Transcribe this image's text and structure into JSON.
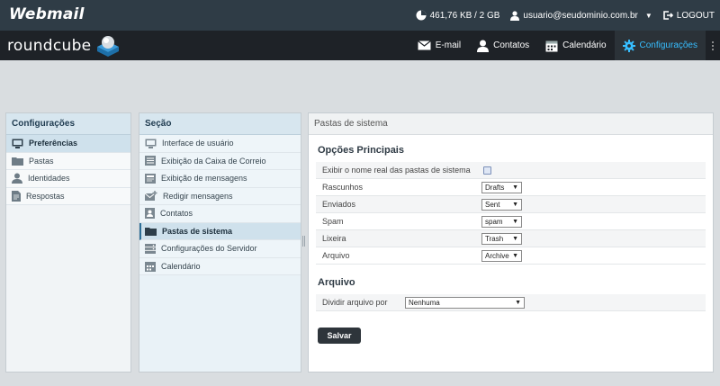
{
  "topbar": {
    "brand": "Webmail",
    "quota": "461,76 KB / 2 GB",
    "user": "usuario@seudominio.com.br",
    "logout": "LOGOUT"
  },
  "header": {
    "logo_text": "roundcube",
    "nav": [
      {
        "label": "E-mail",
        "icon": "envelope-icon"
      },
      {
        "label": "Contatos",
        "icon": "person-icon"
      },
      {
        "label": "Calendário",
        "icon": "calendar-icon"
      },
      {
        "label": "Configurações",
        "icon": "gear-icon",
        "active": true
      }
    ]
  },
  "settings_panel": {
    "title": "Configurações",
    "items": [
      {
        "label": "Preferências",
        "icon": "monitor-icon",
        "selected": true
      },
      {
        "label": "Pastas",
        "icon": "folder-icon"
      },
      {
        "label": "Identidades",
        "icon": "person-icon"
      },
      {
        "label": "Respostas",
        "icon": "document-icon"
      }
    ]
  },
  "section_panel": {
    "title": "Seção",
    "items": [
      {
        "label": "Interface de usuário",
        "icon": "monitor-icon"
      },
      {
        "label": "Exibição da Caixa de Correio",
        "icon": "list-icon"
      },
      {
        "label": "Exibição de mensagens",
        "icon": "message-icon"
      },
      {
        "label": "Redigir mensagens",
        "icon": "compose-icon"
      },
      {
        "label": "Contatos",
        "icon": "contact-card-icon"
      },
      {
        "label": "Pastas de sistema",
        "icon": "folder-icon",
        "selected": true
      },
      {
        "label": "Configurações do Servidor",
        "icon": "server-icon"
      },
      {
        "label": "Calendário",
        "icon": "calendar-icon"
      }
    ]
  },
  "content": {
    "title": "Pastas de sistema",
    "main_section": "Opções Principais",
    "rows": [
      {
        "label": "Exibir o nome real das pastas de sistema",
        "type": "checkbox"
      },
      {
        "label": "Rascunhos",
        "value": "Drafts"
      },
      {
        "label": "Enviados",
        "value": "Sent"
      },
      {
        "label": "Spam",
        "value": "spam"
      },
      {
        "label": "Lixeira",
        "value": "Trash"
      },
      {
        "label": "Arquivo",
        "value": "Archive"
      }
    ],
    "archive_section": "Arquivo",
    "archive_row": {
      "label": "Dividir arquivo por",
      "value": "Nenhuma"
    },
    "save": "Salvar"
  },
  "colors": {
    "accent": "#37beff",
    "topbar": "#2f3c46",
    "header": "#1e2227"
  }
}
